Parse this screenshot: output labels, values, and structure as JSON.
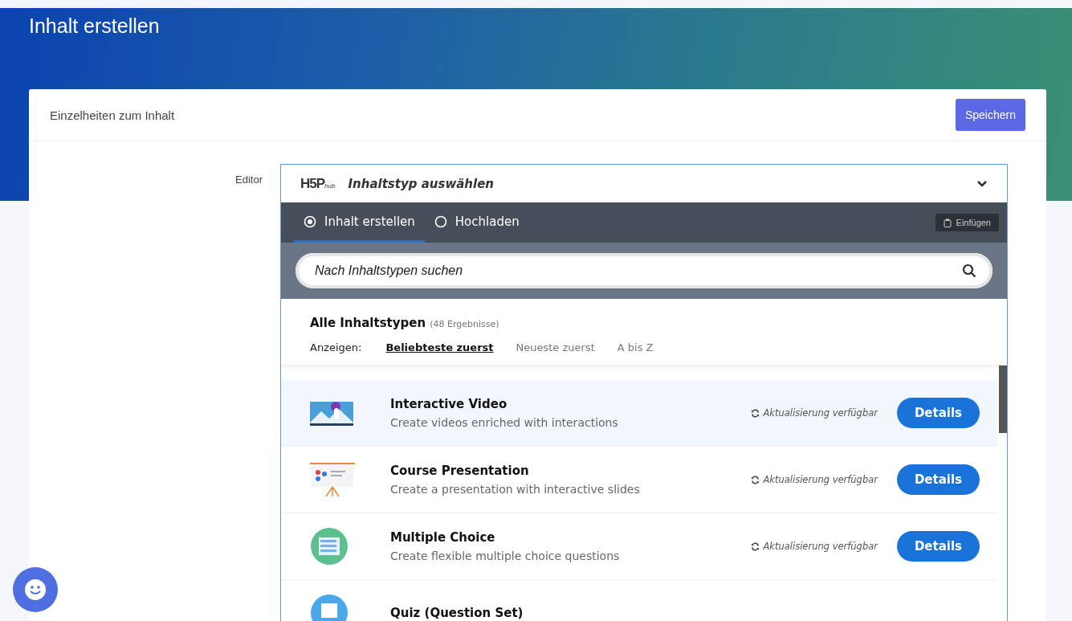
{
  "page_title": "Inhalt erstellen",
  "card": {
    "title": "Einzelheiten zum Inhalt",
    "save_button": "Speichern"
  },
  "field_label": "Editor",
  "selector": {
    "logo_mark": "H5P",
    "logo_sub": "hub",
    "title": "Inhaltstyp auswählen",
    "expanded": true
  },
  "tabs": [
    {
      "label": "Inhalt erstellen",
      "selected": true
    },
    {
      "label": "Hochladen",
      "selected": false
    }
  ],
  "paste_button": "Einfügen",
  "search": {
    "placeholder": "Nach Inhaltstypen suchen"
  },
  "results": {
    "heading": "Alle Inhaltstypen",
    "count": "(48 Ergebnisse)"
  },
  "sort": {
    "label": "Anzeigen:",
    "options": [
      {
        "label": "Beliebteste zuerst",
        "selected": true
      },
      {
        "label": "Neueste zuerst",
        "selected": false
      },
      {
        "label": "A bis Z",
        "selected": false
      }
    ]
  },
  "content_types": [
    {
      "kind": "video",
      "title": "Interactive Video",
      "description": "Create videos enriched with interactions",
      "update": "Aktualisierung verfügbar",
      "button": "Details",
      "selected": true
    },
    {
      "kind": "presentation",
      "title": "Course Presentation",
      "description": "Create a presentation with interactive slides",
      "update": "Aktualisierung verfügbar",
      "button": "Details",
      "selected": false
    },
    {
      "kind": "choice",
      "title": "Multiple Choice",
      "description": "Create flexible multiple choice questions",
      "update": "Aktualisierung verfügbar",
      "button": "Details",
      "selected": false
    },
    {
      "kind": "quiz",
      "title": "Quiz (Question Set)",
      "selected": false
    }
  ]
}
